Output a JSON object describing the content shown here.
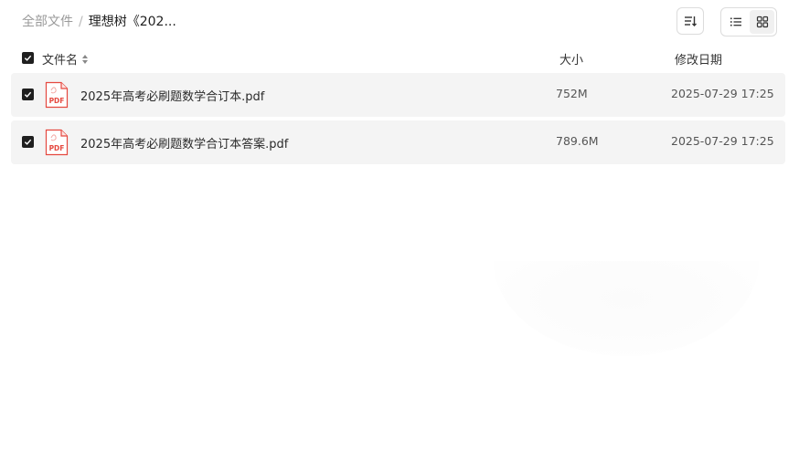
{
  "breadcrumb": {
    "root": "全部文件",
    "separator": "/",
    "current": "理想树《202..."
  },
  "toolbar": {
    "sort_icon": "sort-icon",
    "list_view_icon": "list-view-icon",
    "grid_view_icon": "grid-view-icon",
    "active_view": "list"
  },
  "header": {
    "name": "文件名",
    "size": "大小",
    "date": "修改日期",
    "select_all_checked": true
  },
  "files": [
    {
      "name": "2025年高考必刷题数学合订本.pdf",
      "size": "752M",
      "modified": "2025-07-29 17:25",
      "type_label": "PDF",
      "checked": true
    },
    {
      "name": "2025年高考必刷题数学合订本答案.pdf",
      "size": "789.6M",
      "modified": "2025-07-29 17:25",
      "type_label": "PDF",
      "checked": true
    }
  ],
  "colors": {
    "row_bg": "#f4f4f4",
    "pdf_red": "#e5483f",
    "checkbox": "#1f1f1f"
  }
}
